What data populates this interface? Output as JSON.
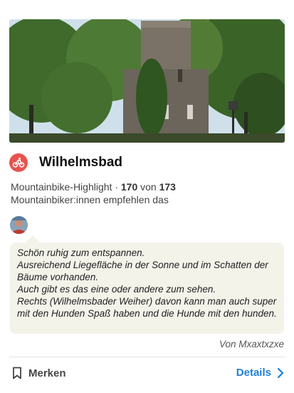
{
  "hero": {
    "alt": "Wilhelmsbad"
  },
  "highlight": {
    "title": "Wilhelmsbad",
    "sport_icon": "mountainbike-icon",
    "category_label": "Mountainbike-Highlight",
    "separator": "·",
    "rank": "170",
    "rank_of": "von",
    "rank_total": "173",
    "recommend_text": "Mountainbiker:innen empfehlen das"
  },
  "tip": {
    "avatar_icon": "user-avatar",
    "text": "Schön ruhig zum entspannen.\nAusreichend Liegefläche in der Sonne und im Schatten der Bäume vorhanden.\nAuch gibt es das eine oder andere zum sehen.\nRechts (Wilhelmsbader Weiher) davon kann man auch super mit den Hunden Spaß haben und die Hunde mit den hunden.",
    "author": "Von Mxaxtxzxe"
  },
  "actions": {
    "save_label": "Merken",
    "save_icon": "bookmark-icon",
    "details_label": "Details",
    "details_icon": "chevron-right-icon"
  },
  "colors": {
    "accent": "#1e7fd6",
    "sport": "#e8534f",
    "bubble_bg": "#f3f3ea"
  }
}
